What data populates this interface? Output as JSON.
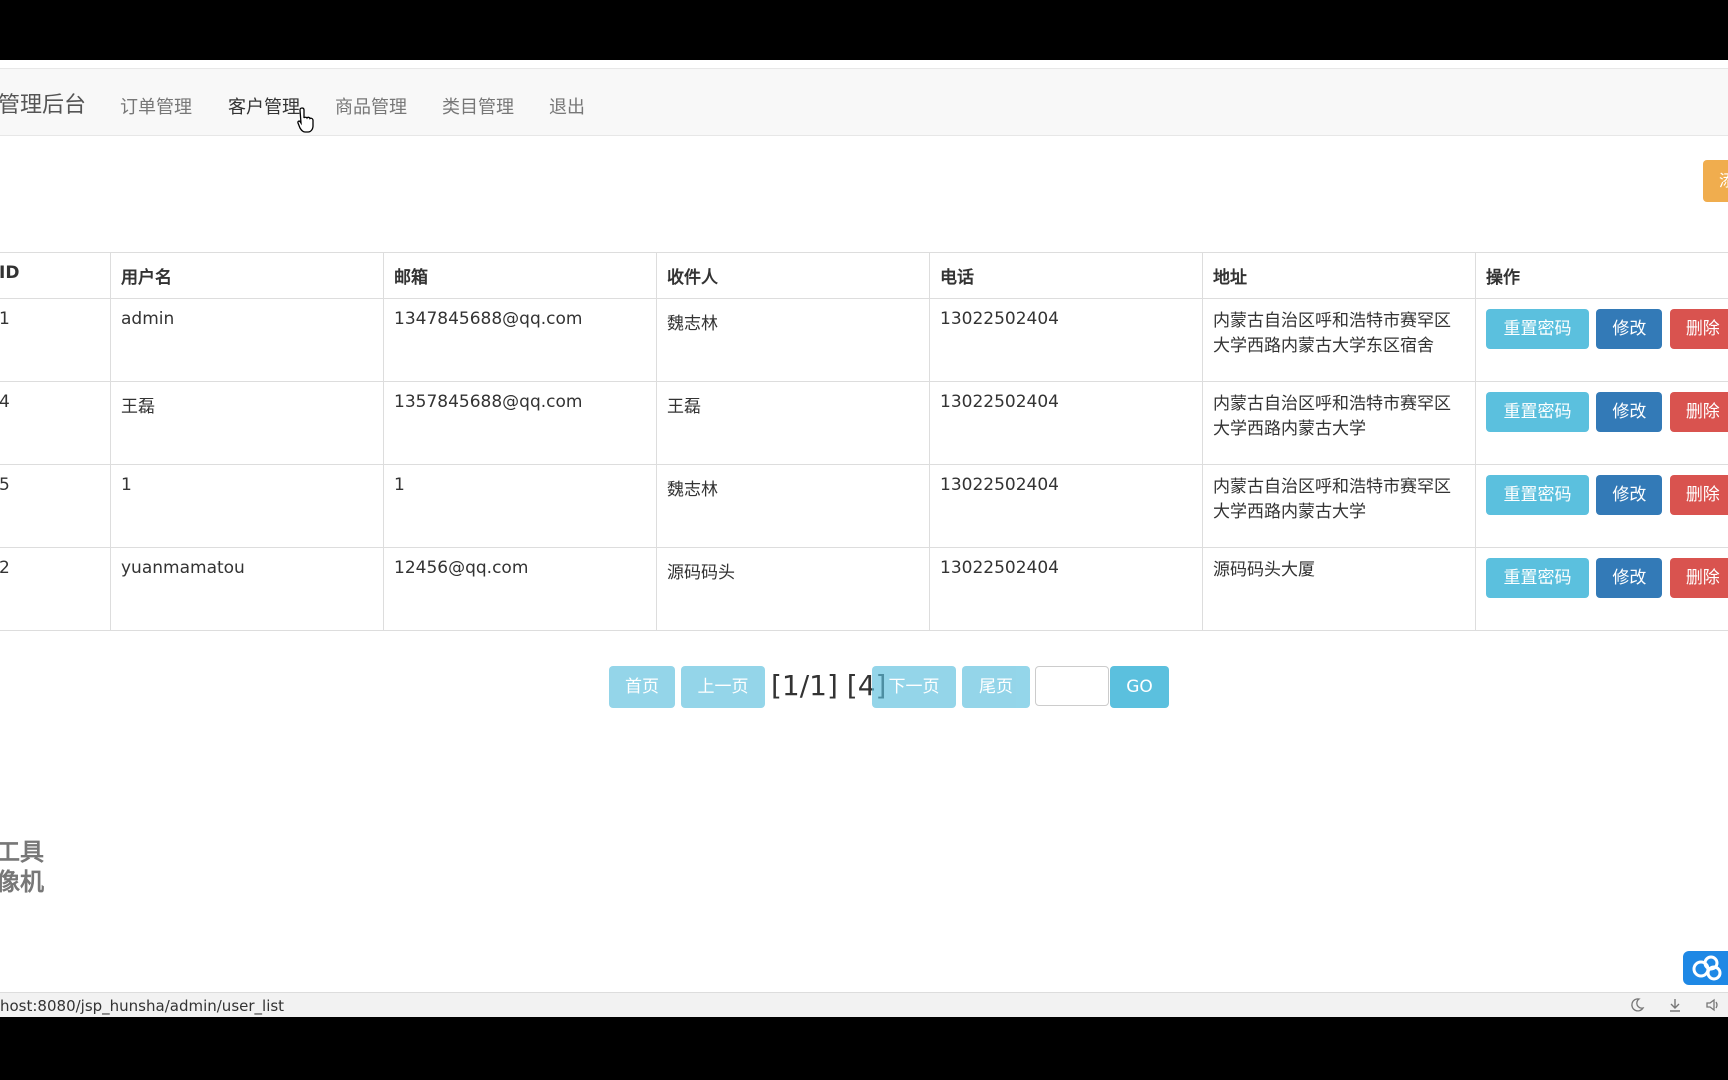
{
  "navbar": {
    "brand": "管理后台",
    "items": [
      {
        "label": "订单管理"
      },
      {
        "label": "客户管理"
      },
      {
        "label": "商品管理"
      },
      {
        "label": "类目管理"
      },
      {
        "label": "退出"
      }
    ]
  },
  "top_right_button": {
    "label": "添"
  },
  "table": {
    "headers": [
      "ID",
      "用户名",
      "邮箱",
      "收件人",
      "电话",
      "地址",
      "操作"
    ],
    "rows": [
      {
        "id": "1",
        "username": "admin",
        "email": "1347845688@qq.com",
        "recipient": "魏志林",
        "phone": "13022502404",
        "address": "内蒙古自治区呼和浩特市赛罕区大学西路内蒙古大学东区宿舍"
      },
      {
        "id": "4",
        "username": "王磊",
        "email": "1357845688@qq.com",
        "recipient": "王磊",
        "phone": "13022502404",
        "address": "内蒙古自治区呼和浩特市赛罕区大学西路内蒙古大学"
      },
      {
        "id": "5",
        "username": "1",
        "email": "1",
        "recipient": "魏志林",
        "phone": "13022502404",
        "address": "内蒙古自治区呼和浩特市赛罕区大学西路内蒙古大学"
      },
      {
        "id": "2",
        "username": "yuanmamatou",
        "email": "12456@qq.com",
        "recipient": "源码码头",
        "phone": "13022502404",
        "address": "源码码头大厦"
      }
    ],
    "actions": {
      "reset": "重置密码",
      "edit": "修改",
      "delete": "删除"
    }
  },
  "pagination": {
    "first": "首页",
    "prev": "上一页",
    "info": "[1/1] [4]",
    "next": "下一页",
    "last": "尾页",
    "input_value": "",
    "go": "GO"
  },
  "watermark": {
    "line1": "工具",
    "line2": "像机"
  },
  "status_bar": {
    "url": "host:8080/jsp_hunsha/admin/user_list"
  }
}
